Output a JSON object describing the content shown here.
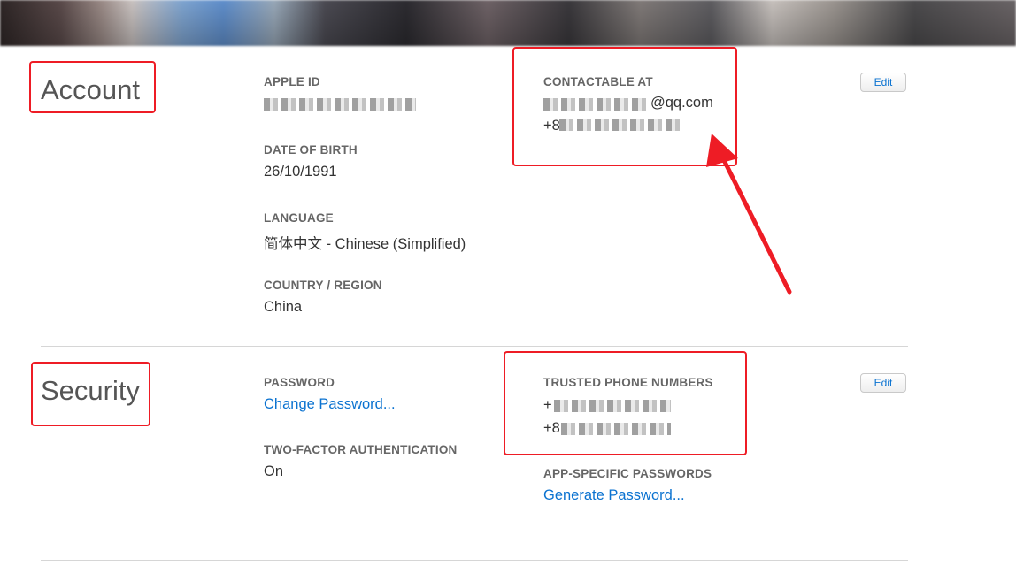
{
  "account": {
    "title": "Account",
    "apple_id_label": "APPLE ID",
    "dob_label": "DATE OF BIRTH",
    "dob_value": "26/10/1991",
    "language_label": "LANGUAGE",
    "language_value": "简体中文 - Chinese (Simplified)",
    "country_label": "COUNTRY / REGION",
    "country_value": "China",
    "contactable_label": "CONTACTABLE AT",
    "contact_email_suffix": "@qq.com",
    "contact_phone_prefix": "+8",
    "edit_label": "Edit"
  },
  "security": {
    "title": "Security",
    "password_label": "PASSWORD",
    "change_password_link": "Change Password...",
    "two_factor_label": "TWO-FACTOR AUTHENTICATION",
    "two_factor_value": "On",
    "trusted_label": "TRUSTED PHONE NUMBERS",
    "trusted_phone_prefix_1": "+",
    "trusted_phone_prefix_2": "+8",
    "app_passwords_label": "APP-SPECIFIC PASSWORDS",
    "generate_password_link": "Generate Password...",
    "edit_label": "Edit"
  },
  "colors": {
    "link": "#0a72d0",
    "annotation": "#ee1c25"
  }
}
